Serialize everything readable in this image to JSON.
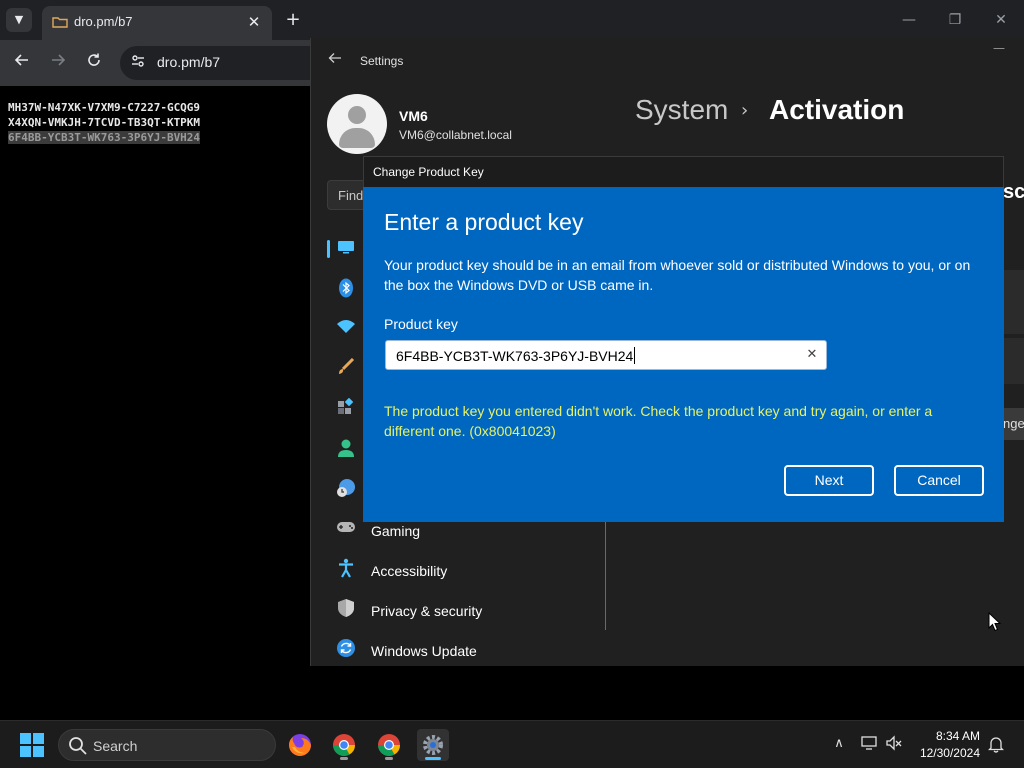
{
  "browser": {
    "tab": {
      "title": "dro.pm/b7",
      "favicon": "folder-icon"
    },
    "address": "dro.pm/b7",
    "page_lines": [
      "MH37W-N47XK-V7XM9-C7227-GCQG9",
      "X4XQN-VMKJH-7TCVD-TB3QT-KTPKM",
      "6F4BB-YCB3T-WK763-3P6YJ-BVH24"
    ]
  },
  "settings": {
    "title": "Settings",
    "user": {
      "name": "VM6",
      "email": "VM6@collabnet.local"
    },
    "breadcrumb": {
      "parent": "System",
      "separator": "›",
      "current": "Activation"
    },
    "find_placeholder": "Find",
    "nav": [
      {
        "id": "system",
        "label": "",
        "icon": "monitor-icon",
        "color": "#4cc2ff"
      },
      {
        "id": "bluetooth",
        "label": "",
        "icon": "bluetooth-icon",
        "color": "#2e8fe6"
      },
      {
        "id": "network",
        "label": "",
        "icon": "wifi-icon",
        "color": "#4cc2ff"
      },
      {
        "id": "personalization",
        "label": "",
        "icon": "brush-icon",
        "color": "#e8a85a"
      },
      {
        "id": "apps",
        "label": "",
        "icon": "apps-icon",
        "color": "#9a9ea6"
      },
      {
        "id": "accounts",
        "label": "",
        "icon": "person-icon",
        "color": "#35c28a"
      },
      {
        "id": "time-language",
        "label": "",
        "icon": "globe-clock-icon",
        "color": "#4c9be8"
      },
      {
        "id": "gaming",
        "label": "Gaming",
        "icon": "gamepad-icon",
        "color": "#b5b5b5"
      },
      {
        "id": "accessibility",
        "label": "Accessibility",
        "icon": "accessibility-icon",
        "color": "#4cc2ff"
      },
      {
        "id": "privacy",
        "label": "Privacy & security",
        "icon": "shield-icon",
        "color": "#a8a8a8"
      },
      {
        "id": "windows-update",
        "label": "Windows Update",
        "icon": "update-icon",
        "color": "#2e8fe6"
      }
    ],
    "edge_text_1": "sc",
    "edge_text_2": "nge"
  },
  "dialog": {
    "title": "Change Product Key",
    "heading": "Enter a product key",
    "description": "Your product key should be in an email from whoever sold or distributed Windows to you, or on the box the Windows DVD or USB came in.",
    "field_label": "Product key",
    "field_value": "6F4BB-YCB3T-WK763-3P6YJ-BVH24",
    "error": "The product key you entered didn't work. Check the product key and try again, or enter a different one. (0x80041023)",
    "next_label": "Next",
    "cancel_label": "Cancel",
    "colors": {
      "body": "#0067c0",
      "error": "#e6f36a"
    }
  },
  "taskbar": {
    "search_label": "Search",
    "apps": [
      "firefox-icon",
      "chrome-icon",
      "chrome-icon",
      "settings-icon"
    ],
    "time": "8:34 AM",
    "date": "12/30/2024"
  }
}
